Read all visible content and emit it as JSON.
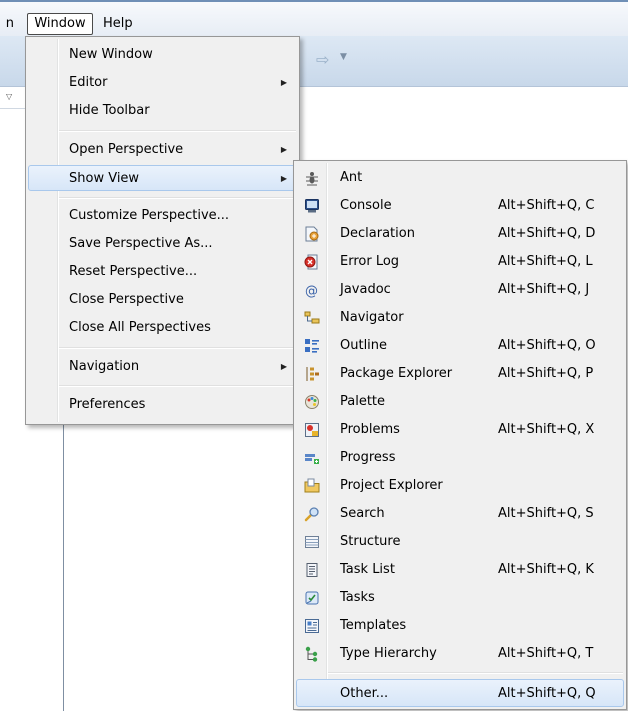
{
  "menubar": {
    "edge_label": "n",
    "window_label": "Window",
    "help_label": "Help"
  },
  "window_menu": {
    "items": [
      {
        "label": "New Window"
      },
      {
        "label": "Editor",
        "submenu": true
      },
      {
        "label": "Hide Toolbar"
      },
      {
        "label": "Open Perspective",
        "submenu": true
      },
      {
        "label": "Show View",
        "submenu": true,
        "highlighted": true
      },
      {
        "label": "Customize Perspective..."
      },
      {
        "label": "Save Perspective As..."
      },
      {
        "label": "Reset Perspective..."
      },
      {
        "label": "Close Perspective"
      },
      {
        "label": "Close All Perspectives"
      },
      {
        "label": "Navigation",
        "submenu": true
      },
      {
        "label": "Preferences"
      }
    ]
  },
  "show_view_menu": {
    "items": [
      {
        "label": "Ant",
        "shortcut": "",
        "icon": "ant-icon"
      },
      {
        "label": "Console",
        "shortcut": "Alt+Shift+Q, C",
        "icon": "console-icon"
      },
      {
        "label": "Declaration",
        "shortcut": "Alt+Shift+Q, D",
        "icon": "declaration-icon"
      },
      {
        "label": "Error Log",
        "shortcut": "Alt+Shift+Q, L",
        "icon": "error-log-icon"
      },
      {
        "label": "Javadoc",
        "shortcut": "Alt+Shift+Q, J",
        "icon": "javadoc-icon"
      },
      {
        "label": "Navigator",
        "shortcut": "",
        "icon": "navigator-icon"
      },
      {
        "label": "Outline",
        "shortcut": "Alt+Shift+Q, O",
        "icon": "outline-icon"
      },
      {
        "label": "Package Explorer",
        "shortcut": "Alt+Shift+Q, P",
        "icon": "package-explorer-icon"
      },
      {
        "label": "Palette",
        "shortcut": "",
        "icon": "palette-icon"
      },
      {
        "label": "Problems",
        "shortcut": "Alt+Shift+Q, X",
        "icon": "problems-icon"
      },
      {
        "label": "Progress",
        "shortcut": "",
        "icon": "progress-icon"
      },
      {
        "label": "Project Explorer",
        "shortcut": "",
        "icon": "project-explorer-icon"
      },
      {
        "label": "Search",
        "shortcut": "Alt+Shift+Q, S",
        "icon": "search-icon"
      },
      {
        "label": "Structure",
        "shortcut": "",
        "icon": "structure-icon"
      },
      {
        "label": "Task List",
        "shortcut": "Alt+Shift+Q, K",
        "icon": "task-list-icon"
      },
      {
        "label": "Tasks",
        "shortcut": "",
        "icon": "tasks-icon"
      },
      {
        "label": "Templates",
        "shortcut": "",
        "icon": "templates-icon"
      },
      {
        "label": "Type Hierarchy",
        "shortcut": "Alt+Shift+Q, T",
        "icon": "type-hierarchy-icon"
      },
      {
        "label": "Other...",
        "shortcut": "Alt+Shift+Q, Q",
        "icon": "",
        "highlighted": true
      }
    ]
  },
  "colors": {
    "highlight_border": "#a9c8ec",
    "highlight_fill": "#d7e6f8",
    "menu_background": "#f0f0f0",
    "toolbar": "#c8d8ea"
  }
}
